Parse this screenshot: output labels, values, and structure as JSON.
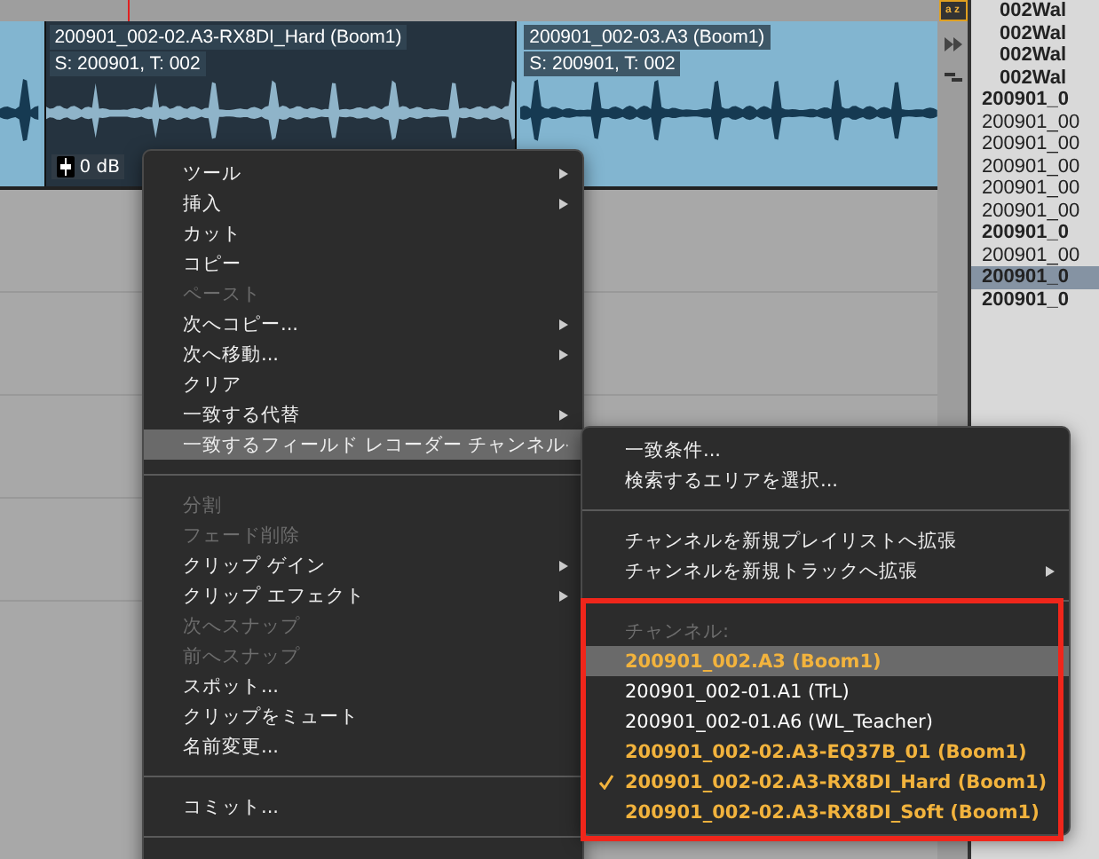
{
  "track": {
    "clips": [
      {
        "selected": false
      },
      {
        "name": "200901_002-02.A3-RX8DI_Hard (Boom1)",
        "scene": "S: 200901, T: 002",
        "selected": true,
        "gain": "0 dB"
      },
      {
        "name": "200901_002-03.A3 (Boom1)",
        "scene": "S: 200901, T: 002",
        "selected": false
      }
    ]
  },
  "sort_button": {
    "label": "a z"
  },
  "clip_list": {
    "items": [
      {
        "label": "002Wal",
        "bold": true,
        "selected": false
      },
      {
        "label": "002Wal",
        "bold": true,
        "selected": false
      },
      {
        "label": "002Wal",
        "bold": true,
        "selected": false
      },
      {
        "label": "002Wal",
        "bold": true,
        "selected": false
      },
      {
        "label": "200901_0",
        "bold": true,
        "selected": false
      },
      {
        "label": "200901_00",
        "bold": false,
        "selected": false
      },
      {
        "label": "200901_00",
        "bold": false,
        "selected": false
      },
      {
        "label": "200901_00",
        "bold": false,
        "selected": false
      },
      {
        "label": "200901_00",
        "bold": false,
        "selected": false
      },
      {
        "label": "200901_00",
        "bold": false,
        "selected": false
      },
      {
        "label": "200901_0",
        "bold": true,
        "selected": false
      },
      {
        "label": "200901_00",
        "bold": false,
        "selected": false
      },
      {
        "label": "200901_0",
        "bold": true,
        "selected": true
      },
      {
        "label": "200901_0",
        "bold": true,
        "selected": false
      }
    ]
  },
  "context_menu": {
    "items": [
      {
        "kind": "item",
        "label": "ツール",
        "disabled": false,
        "submenu": true,
        "selected": false
      },
      {
        "kind": "item",
        "label": "挿入",
        "disabled": false,
        "submenu": true,
        "selected": false
      },
      {
        "kind": "item",
        "label": "カット",
        "disabled": false,
        "submenu": false,
        "selected": false
      },
      {
        "kind": "item",
        "label": "コピー",
        "disabled": false,
        "submenu": false,
        "selected": false
      },
      {
        "kind": "item",
        "label": "ペースト",
        "disabled": true,
        "submenu": false,
        "selected": false
      },
      {
        "kind": "item",
        "label": "次へコピー...",
        "disabled": false,
        "submenu": true,
        "selected": false
      },
      {
        "kind": "item",
        "label": "次へ移動...",
        "disabled": false,
        "submenu": true,
        "selected": false
      },
      {
        "kind": "item",
        "label": "クリア",
        "disabled": false,
        "submenu": false,
        "selected": false
      },
      {
        "kind": "item",
        "label": "一致する代替",
        "disabled": false,
        "submenu": true,
        "selected": false
      },
      {
        "kind": "item",
        "label": "一致するフィールド レコーダー チャンネル",
        "disabled": false,
        "submenu": true,
        "selected": true
      },
      {
        "kind": "separator"
      },
      {
        "kind": "item",
        "label": "分割",
        "disabled": true,
        "submenu": false,
        "selected": false
      },
      {
        "kind": "item",
        "label": "フェード削除",
        "disabled": true,
        "submenu": false,
        "selected": false
      },
      {
        "kind": "item",
        "label": "クリップ ゲイン",
        "disabled": false,
        "submenu": true,
        "selected": false
      },
      {
        "kind": "item",
        "label": "クリップ エフェクト",
        "disabled": false,
        "submenu": true,
        "selected": false
      },
      {
        "kind": "item",
        "label": "次へスナップ",
        "disabled": true,
        "submenu": false,
        "selected": false
      },
      {
        "kind": "item",
        "label": "前へスナップ",
        "disabled": true,
        "submenu": false,
        "selected": false
      },
      {
        "kind": "item",
        "label": "スポット...",
        "disabled": false,
        "submenu": false,
        "selected": false
      },
      {
        "kind": "item",
        "label": "クリップをミュート",
        "disabled": false,
        "submenu": false,
        "selected": false
      },
      {
        "kind": "item",
        "label": "名前変更...",
        "disabled": false,
        "submenu": false,
        "selected": false
      },
      {
        "kind": "separator"
      },
      {
        "kind": "item",
        "label": "コミット...",
        "disabled": false,
        "submenu": false,
        "selected": false
      },
      {
        "kind": "separator"
      }
    ]
  },
  "submenu": {
    "items": [
      {
        "kind": "item",
        "label": "一致条件...",
        "submenu": false
      },
      {
        "kind": "item",
        "label": "検索するエリアを選択...",
        "submenu": false
      },
      {
        "kind": "separator"
      },
      {
        "kind": "item",
        "label": "チャンネルを新規プレイリストへ拡張",
        "submenu": false
      },
      {
        "kind": "item",
        "label": "チャンネルを新規トラックへ拡張",
        "submenu": true
      },
      {
        "kind": "separator"
      },
      {
        "kind": "header",
        "label": "チャンネル:"
      },
      {
        "kind": "channel",
        "label": "200901_002.A3 (Boom1)",
        "color": "#f2b33d",
        "bold": true,
        "checked": false,
        "selected": true
      },
      {
        "kind": "channel",
        "label": "200901_002-01.A1 (TrL)",
        "color": "#ffffff",
        "bold": false,
        "checked": false,
        "selected": false
      },
      {
        "kind": "channel",
        "label": "200901_002-01.A6 (WL_Teacher)",
        "color": "#ffffff",
        "bold": false,
        "checked": false,
        "selected": false
      },
      {
        "kind": "channel",
        "label": "200901_002-02.A3-EQ37B_01 (Boom1)",
        "color": "#f2b33d",
        "bold": true,
        "checked": false,
        "selected": false
      },
      {
        "kind": "channel",
        "label": "200901_002-02.A3-RX8DI_Hard (Boom1)",
        "color": "#f2b33d",
        "bold": true,
        "checked": true,
        "selected": false
      },
      {
        "kind": "channel",
        "label": "200901_002-02.A3-RX8DI_Soft (Boom1)",
        "color": "#f2b33d",
        "bold": true,
        "checked": false,
        "selected": false
      }
    ]
  }
}
